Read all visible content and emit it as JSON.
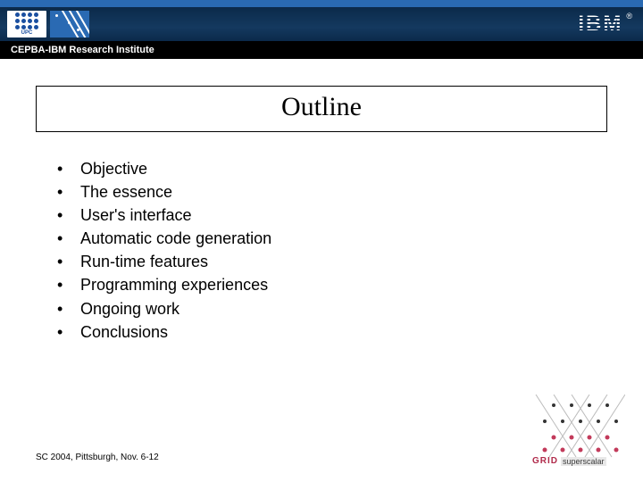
{
  "header": {
    "institute_label": "CEPBA-IBM Research Institute",
    "upc_label": "UPC",
    "ibm_label": "IBM",
    "reg": "®"
  },
  "title": "Outline",
  "bullets": [
    "Objective",
    "The essence",
    "User's interface",
    "Automatic code generation",
    "Run-time features",
    "Programming experiences",
    "Ongoing work",
    "Conclusions"
  ],
  "footer": "SC 2004, Pittsburgh, Nov. 6-12",
  "corner": {
    "grid": "GRID",
    "super": "superscalar"
  }
}
